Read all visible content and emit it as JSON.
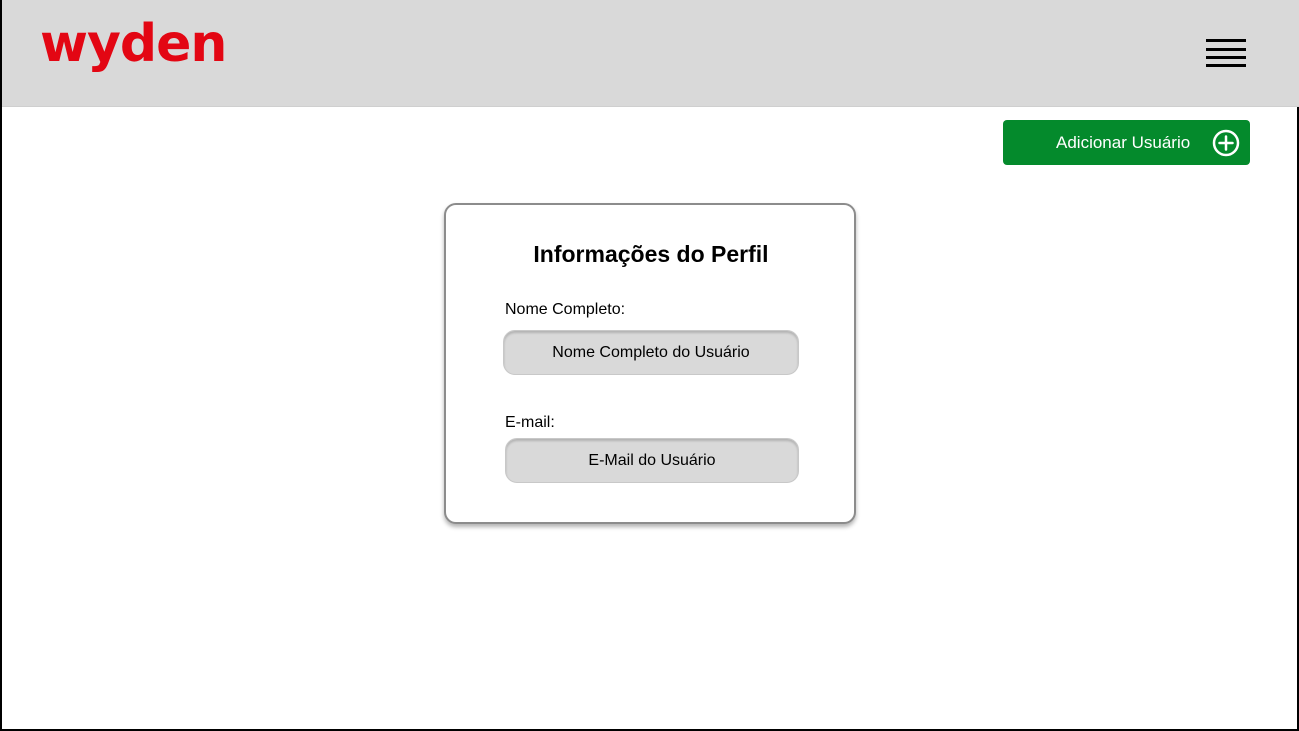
{
  "header": {
    "logo_text": "wyden",
    "menu_icon": "hamburger-menu-icon"
  },
  "toolbar": {
    "add_user_label": "Adicionar Usuário",
    "add_icon": "plus-circle-icon"
  },
  "profile": {
    "title": "Informações do Perfil",
    "name_label": "Nome Completo:",
    "name_value": "Nome Completo do Usuário",
    "email_label": "E-mail:",
    "email_value": "E-Mail do Usuário"
  },
  "colors": {
    "brand": "#e30613",
    "header_bg": "#d9d9d9",
    "primary_button": "#048a2c",
    "field_bg": "#d9d9d9"
  }
}
